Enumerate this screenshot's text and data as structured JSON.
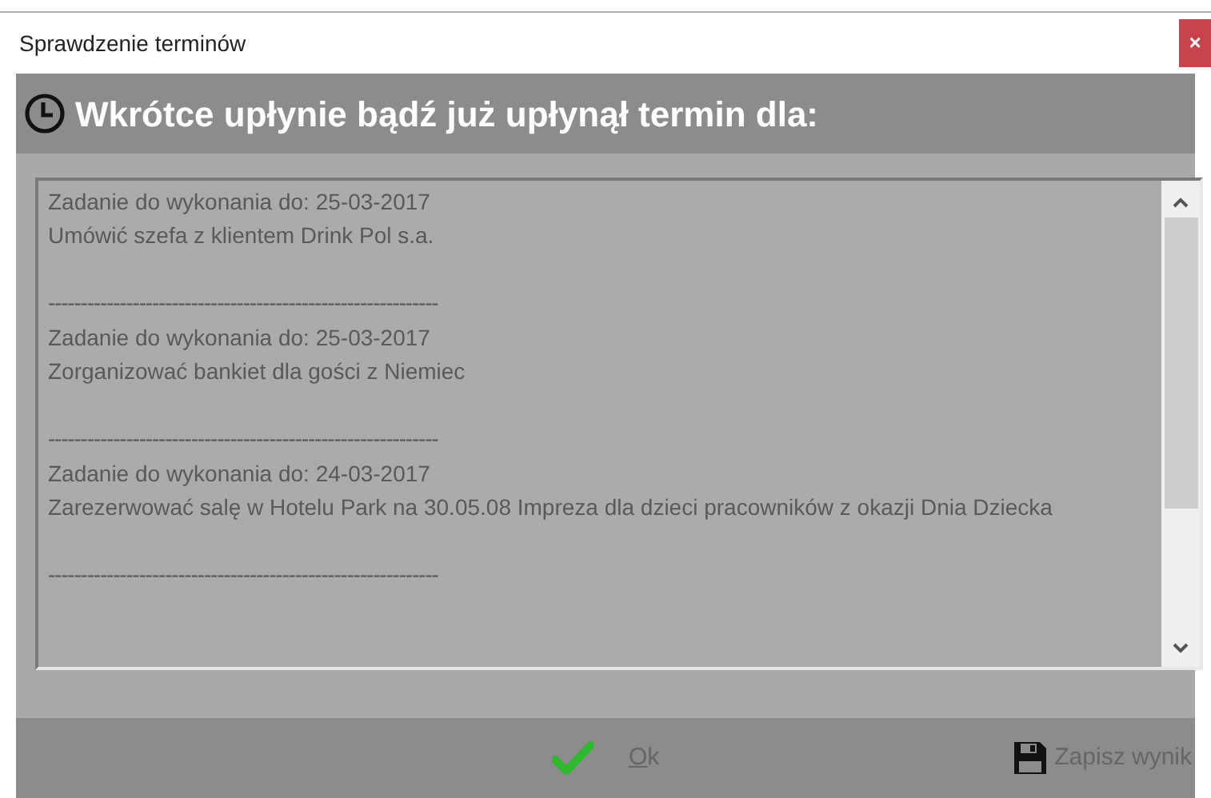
{
  "window": {
    "title": "Sprawdzenie terminów",
    "close": "×"
  },
  "header": {
    "title": "Wkrótce upłynie bądź już upłynął termin dla:"
  },
  "entries": [
    {
      "deadline": "Zadanie do wykonania do: 25-03-2017",
      "task": "Umówić szefa z klientem Drink Pol s.a.",
      "separator": "------------------------------------------------------------"
    },
    {
      "deadline": "Zadanie do wykonania do: 25-03-2017",
      "task": "Zorganizować bankiet dla gości z Niemiec",
      "separator": "------------------------------------------------------------"
    },
    {
      "deadline": "Zadanie do wykonania do: 24-03-2017",
      "task": "Zarezerwować salę w Hotelu Park na 30.05.08 Impreza dla dzieci pracowników z okazji Dnia Dziecka",
      "separator": "------------------------------------------------------------"
    }
  ],
  "buttons": [
    {
      "kind": "ok",
      "label": "Ok"
    },
    {
      "kind": "save",
      "label": "Zapisz wynik"
    }
  ]
}
